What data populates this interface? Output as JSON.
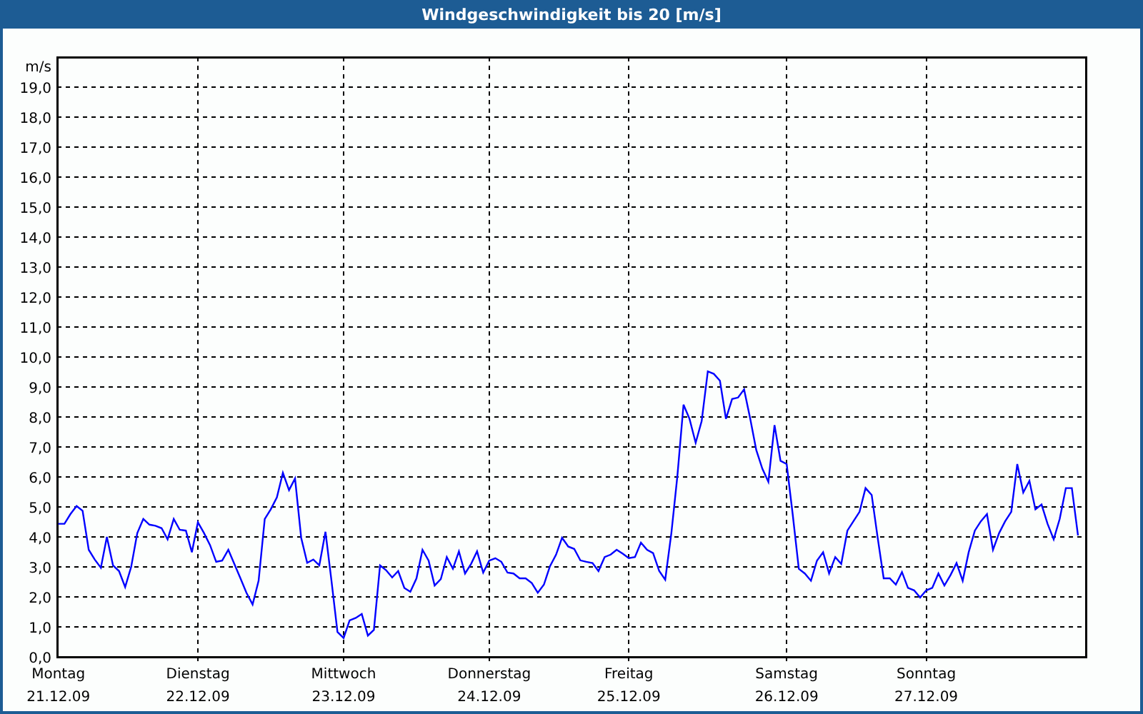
{
  "chart_data": {
    "type": "line",
    "title": "Windgeschwindigkeit bis 20 [m/s]",
    "ylabel": "m/s",
    "ylim": [
      0,
      20
    ],
    "grid": true,
    "yticks": [
      {
        "value": 0,
        "label": "0,0"
      },
      {
        "value": 1,
        "label": "1,0"
      },
      {
        "value": 2,
        "label": "2,0"
      },
      {
        "value": 3,
        "label": "3,0"
      },
      {
        "value": 4,
        "label": "4,0"
      },
      {
        "value": 5,
        "label": "5,0"
      },
      {
        "value": 6,
        "label": "6,0"
      },
      {
        "value": 7,
        "label": "7,0"
      },
      {
        "value": 8,
        "label": "8,0"
      },
      {
        "value": 9,
        "label": "9,0"
      },
      {
        "value": 10,
        "label": "10,0"
      },
      {
        "value": 11,
        "label": "11,0"
      },
      {
        "value": 12,
        "label": "12,0"
      },
      {
        "value": 13,
        "label": "13,0"
      },
      {
        "value": 14,
        "label": "14,0"
      },
      {
        "value": 15,
        "label": "15,0"
      },
      {
        "value": 16,
        "label": "16,0"
      },
      {
        "value": 17,
        "label": "17,0"
      },
      {
        "value": 18,
        "label": "18,0"
      },
      {
        "value": 19,
        "label": "19,0"
      }
    ],
    "categories": [
      "Montag\n21.12.09",
      null,
      null,
      null,
      null,
      null,
      null,
      null,
      null,
      null,
      null,
      null,
      null,
      null,
      null,
      null,
      null,
      null,
      null,
      null,
      null,
      null,
      null,
      "Dienstag\n22.12.09",
      null,
      null,
      null,
      null,
      null,
      null,
      null,
      null,
      null,
      null,
      null,
      null,
      null,
      null,
      null,
      null,
      null,
      null,
      null,
      null,
      null,
      null,
      null,
      "Mittwoch\n23.12.09",
      null,
      null,
      null,
      null,
      null,
      null,
      null,
      null,
      null,
      null,
      null,
      null,
      null,
      null,
      null,
      null,
      null,
      null,
      null,
      null,
      null,
      null,
      null,
      "Donnerstag\n24.12.09",
      null,
      null,
      null,
      null,
      null,
      null,
      null,
      null,
      null,
      null,
      null,
      null,
      null,
      null,
      null,
      null,
      null,
      null,
      null,
      null,
      null,
      null,
      "Freitag\n25.12.09",
      null,
      null,
      null,
      null,
      null,
      null,
      null,
      null,
      null,
      null,
      null,
      null,
      null,
      null,
      null,
      null,
      null,
      null,
      null,
      null,
      null,
      null,
      null,
      null,
      null,
      "Samstag\n26.12.09",
      null,
      null,
      null,
      null,
      null,
      null,
      null,
      null,
      null,
      null,
      null,
      null,
      null,
      null,
      null,
      null,
      null,
      null,
      null,
      null,
      null,
      null,
      "Sonntag\n27.12.09",
      null,
      null,
      null,
      null,
      null,
      null,
      null,
      null,
      null,
      null,
      null,
      null,
      null,
      null,
      null,
      null,
      null,
      null,
      null,
      null,
      null,
      null,
      null,
      null,
      null
    ],
    "series": [
      {
        "color": "#0000ff",
        "values": [
          4.44,
          4.44,
          4.76,
          5.03,
          4.87,
          3.57,
          3.25,
          2.97,
          4.0,
          3.05,
          2.86,
          2.33,
          3.0,
          4.13,
          4.6,
          4.41,
          4.37,
          4.29,
          3.92,
          4.6,
          4.24,
          4.21,
          3.49,
          4.49,
          4.13,
          3.73,
          3.17,
          3.21,
          3.57,
          3.1,
          2.62,
          2.14,
          1.75,
          2.54,
          4.6,
          4.92,
          5.32,
          6.14,
          5.56,
          5.95,
          3.97,
          3.14,
          3.25,
          3.05,
          4.17,
          2.54,
          0.83,
          0.63,
          1.22,
          1.3,
          1.43,
          0.71,
          0.9,
          3.05,
          2.89,
          2.65,
          2.86,
          2.3,
          2.17,
          2.62,
          3.57,
          3.21,
          2.38,
          2.59,
          3.33,
          2.94,
          3.52,
          2.78,
          3.1,
          3.52,
          2.81,
          3.21,
          3.29,
          3.17,
          2.81,
          2.78,
          2.62,
          2.62,
          2.46,
          2.14,
          2.41,
          3.02,
          3.41,
          3.97,
          3.68,
          3.6,
          3.22,
          3.17,
          3.13,
          2.86,
          3.33,
          3.41,
          3.57,
          3.44,
          3.29,
          3.33,
          3.81,
          3.57,
          3.46,
          2.86,
          2.57,
          4.13,
          6.03,
          8.41,
          7.94,
          7.14,
          7.86,
          9.52,
          9.44,
          9.21,
          7.94,
          8.6,
          8.65,
          8.92,
          7.94,
          6.9,
          6.27,
          5.84,
          7.73,
          6.54,
          6.43,
          4.76,
          2.94,
          2.78,
          2.54,
          3.21,
          3.49,
          2.78,
          3.33,
          3.1,
          4.21,
          4.52,
          4.84,
          5.63,
          5.4,
          3.97,
          2.62,
          2.62,
          2.41,
          2.83,
          2.3,
          2.22,
          1.98,
          2.22,
          2.3,
          2.78,
          2.38,
          2.73,
          3.13,
          2.54,
          3.49,
          4.21,
          4.52,
          4.76,
          3.57,
          4.13,
          4.52,
          4.84,
          6.43,
          5.48,
          5.87,
          4.92,
          5.08,
          4.44,
          3.92,
          4.6,
          5.63,
          5.63,
          4.05
        ]
      }
    ]
  }
}
